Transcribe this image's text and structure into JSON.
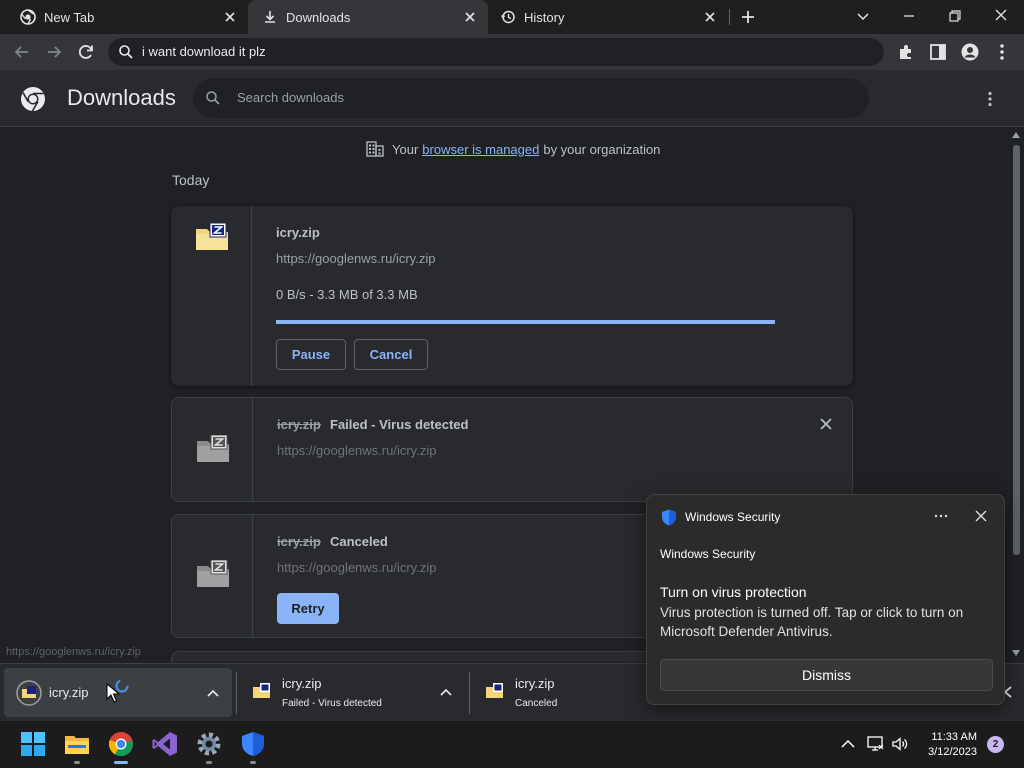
{
  "browser": {
    "tabs": [
      {
        "label": "New Tab",
        "active": false
      },
      {
        "label": "Downloads",
        "active": true
      },
      {
        "label": "History",
        "active": false
      }
    ],
    "omnibox_text": "i want download it plz"
  },
  "page": {
    "title": "Downloads",
    "search_placeholder": "Search downloads",
    "managed_prefix": "Your",
    "managed_link": "browser is managed",
    "managed_suffix": "by your organization",
    "section_label": "Today"
  },
  "downloads": [
    {
      "filename": "icry.zip",
      "url": "https://googlenws.ru/icry.zip",
      "progress_text": "0 B/s - 3.3 MB of 3.3 MB",
      "progress": 1.0,
      "pause_label": "Pause",
      "cancel_label": "Cancel"
    },
    {
      "filename": "icry.zip",
      "status": "Failed - Virus detected",
      "url": "https://googlenws.ru/icry.zip"
    },
    {
      "filename": "icry.zip",
      "status": "Canceled",
      "url": "https://googlenws.ru/icry.zip",
      "retry_label": "Retry"
    }
  ],
  "status_bar_url": "https://googlenws.ru/icry.zip",
  "shelf": [
    {
      "name": "icry.zip",
      "status": ""
    },
    {
      "name": "icry.zip",
      "status": "Failed - Virus detected"
    },
    {
      "name": "icry.zip",
      "status": "Canceled"
    }
  ],
  "toast": {
    "app_name": "Windows Security",
    "subtitle": "Windows Security",
    "heading": "Turn on virus protection",
    "body": "Virus protection is turned off. Tap or click to turn on Microsoft Defender Antivirus.",
    "dismiss_label": "Dismiss"
  },
  "taskbar": {
    "time": "11:33 AM",
    "date": "3/12/2023",
    "notification_count": "2"
  },
  "colors": {
    "accent": "#8ab4f8",
    "page_bg": "#202124",
    "toolbar_bg": "#35363a"
  }
}
